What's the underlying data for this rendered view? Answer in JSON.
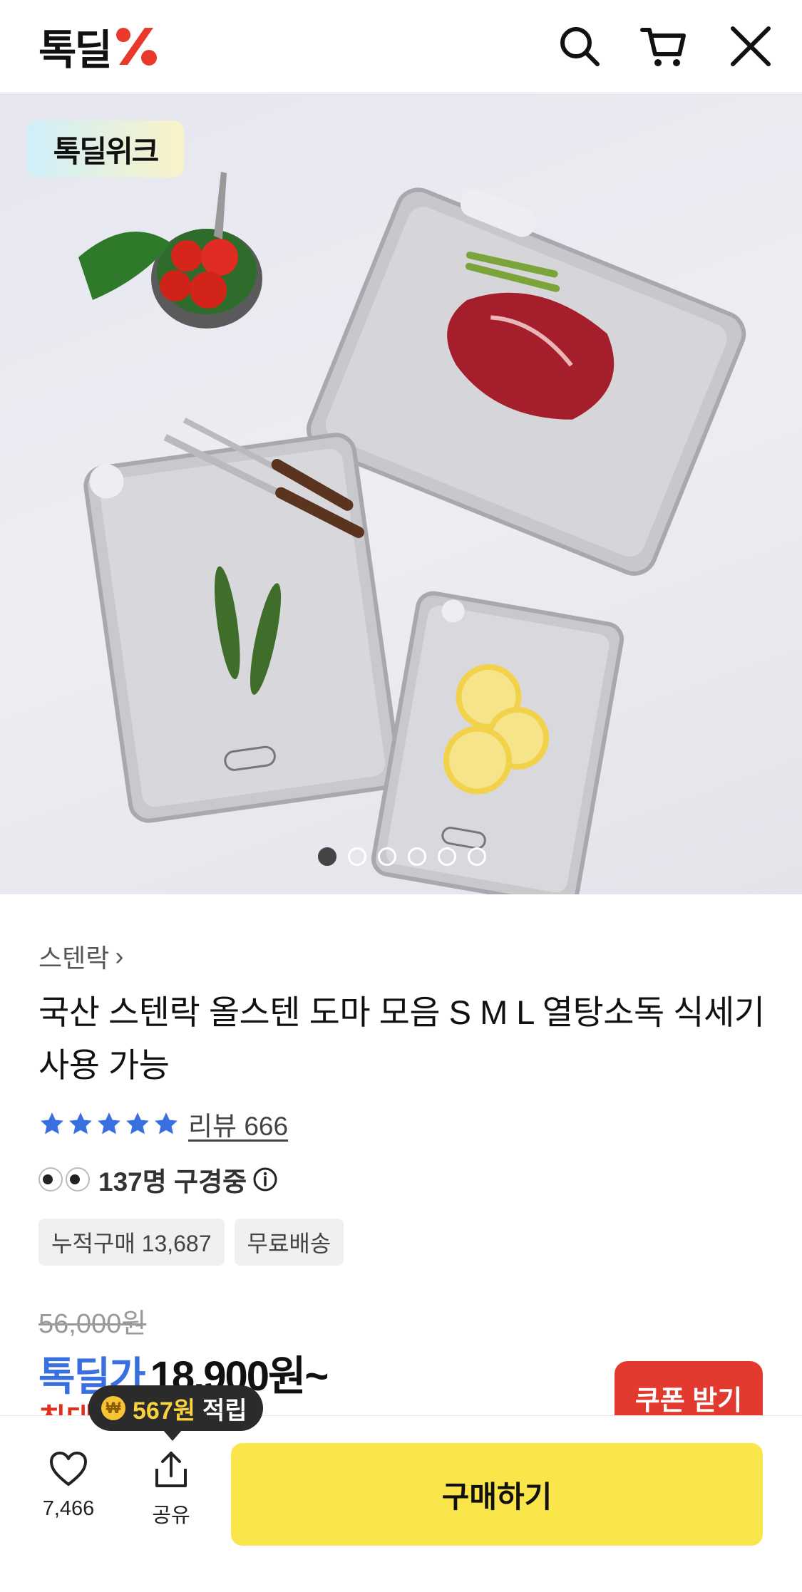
{
  "header": {
    "logo_text": "톡딜",
    "icons": [
      "search-icon",
      "cart-icon",
      "close-icon"
    ]
  },
  "hero": {
    "badge": "톡딜위크",
    "slide_count": 6,
    "active_slide": 1
  },
  "product": {
    "brand": "스텐락",
    "brand_chevron": "›",
    "title": "국산 스텐락 올스텐 도마 모음 S M L 열탕소독 식세기 사용 가능",
    "rating_stars": 5,
    "review_link": "리뷰 666",
    "viewing": "137명 구경중",
    "chips": [
      "누적구매 13,687",
      "무료배송"
    ],
    "original_price": "56,000원",
    "price_label": "톡딜가",
    "price_value": "18,900원~",
    "max_partial": "최대",
    "coupon_button": "쿠폰 받기"
  },
  "tooltip": {
    "amount": "567원",
    "suffix": "적립"
  },
  "bottom_bar": {
    "like_count": "7,466",
    "share_label": "공유",
    "buy_button": "구매하기"
  },
  "colors": {
    "accent_blue": "#3a6fe0",
    "coupon_red": "#e23a2e",
    "buy_yellow": "#fae54a",
    "logo_red": "#e8392b"
  }
}
